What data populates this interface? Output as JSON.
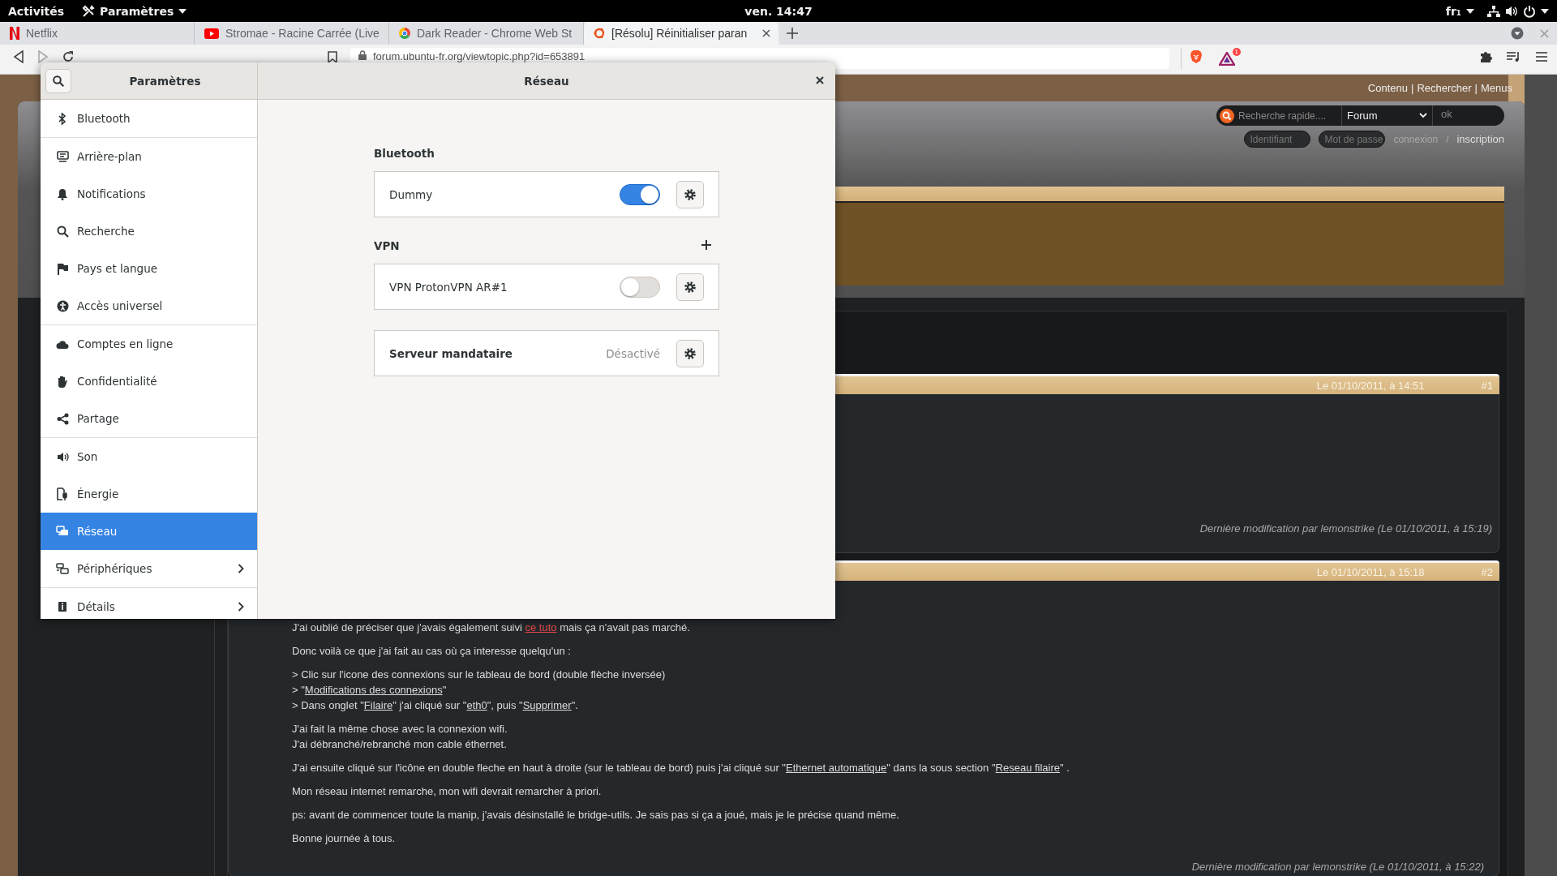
{
  "top_bar": {
    "activities": "Activités",
    "app_menu": "Paramètres",
    "clock": "ven. 14:47",
    "keyboard_layout": "fr₁"
  },
  "browser": {
    "tabs": [
      {
        "title": "Netflix",
        "selected": false
      },
      {
        "title": "Stromae - Racine Carrée (Live",
        "selected": false
      },
      {
        "title": "Dark Reader - Chrome Web St",
        "selected": false
      },
      {
        "title": "[Résolu] Réinitialiser paran",
        "selected": true
      }
    ],
    "address": "forum.ubuntu-fr.org/viewtopic.php?id=653891",
    "rewards_badge": "1"
  },
  "forum": {
    "top_links": [
      "Contenu",
      "Rechercher",
      "Menus"
    ],
    "link_separator": "|",
    "search": {
      "placeholder": "Recherche rapide....",
      "scope": "Forum",
      "submit": "ok"
    },
    "login": {
      "username_placeholder": "Identifiant",
      "password_placeholder": "Mot de passe",
      "login_link": "connexion",
      "separator": "/",
      "register_link": "inscription"
    },
    "posts": [
      {
        "date": "Le 01/10/2011, à 14:51",
        "number": "#1",
        "edit_note": "Dernière modification par lemonstrike (Le 01/10/2011, à 15:19)"
      },
      {
        "date": "Le 01/10/2011, à 15:18",
        "number": "#2",
        "paragraphs": [
          {
            "lines": [
              [
                {
                  "kind": "text",
                  "text": "J'ai oublié de préciser que j'avais également suivi "
                },
                {
                  "kind": "link",
                  "text": "ce tuto",
                  "color": "#e5484d"
                },
                {
                  "kind": "text",
                  "text": " mais ça n'avait pas marché."
                }
              ]
            ]
          },
          {
            "lines": [
              [
                {
                  "kind": "text",
                  "text": "Donc voilà ce que j'ai fait au cas où ça interesse quelqu'un :"
                }
              ]
            ]
          },
          {
            "lines": [
              [
                {
                  "kind": "text",
                  "text": "> Clic sur l'icone des connexions sur le tableau de bord (double flèche inversée)"
                }
              ],
              [
                {
                  "kind": "text",
                  "text": "> \""
                },
                {
                  "kind": "link",
                  "text": "Modifications des connexions",
                  "color": "#dcdcdc"
                },
                {
                  "kind": "text",
                  "text": "\""
                }
              ],
              [
                {
                  "kind": "text",
                  "text": "> Dans onglet \""
                },
                {
                  "kind": "link",
                  "text": "Filaire",
                  "color": "#dcdcdc"
                },
                {
                  "kind": "text",
                  "text": "\" j'ai cliqué sur \""
                },
                {
                  "kind": "link",
                  "text": "eth0",
                  "color": "#dcdcdc"
                },
                {
                  "kind": "text",
                  "text": "\", puis \""
                },
                {
                  "kind": "link",
                  "text": "Supprimer",
                  "color": "#dcdcdc"
                },
                {
                  "kind": "text",
                  "text": "\"."
                }
              ]
            ]
          },
          {
            "lines": [
              [
                {
                  "kind": "text",
                  "text": "J'ai fait la même chose avec la connexion wifi."
                }
              ],
              [
                {
                  "kind": "text",
                  "text": "J'ai débranché/rebranché mon cable éthernet."
                }
              ]
            ]
          },
          {
            "lines": [
              [
                {
                  "kind": "text",
                  "text": "J'ai ensuite cliqué sur l'icône en double fleche en haut à droite (sur le tableau de bord) puis j'ai cliqué sur \""
                },
                {
                  "kind": "link",
                  "text": "Ethernet automatique",
                  "color": "#dcdcdc"
                },
                {
                  "kind": "text",
                  "text": "\" dans la sous section \""
                },
                {
                  "kind": "link",
                  "text": "Reseau filaire",
                  "color": "#dcdcdc"
                },
                {
                  "kind": "text",
                  "text": "\" ."
                }
              ]
            ]
          },
          {
            "lines": [
              [
                {
                  "kind": "text",
                  "text": "Mon réseau internet remarche, mon wifi devrait remarcher à priori."
                }
              ]
            ]
          },
          {
            "lines": [
              [
                {
                  "kind": "text",
                  "text": "ps: avant de commencer toute la manip, j'avais désinstallé le bridge-utils. Je sais pas si ça a joué, mais je le précise quand même."
                }
              ]
            ]
          },
          {
            "lines": [
              [
                {
                  "kind": "text",
                  "text": "Bonne journée à tous."
                }
              ]
            ]
          }
        ],
        "edit_note": "Dernière modification par lemonstrike (Le 01/10/2011, à 15:22)"
      }
    ]
  },
  "settings": {
    "sidebar_title": "Paramètres",
    "page_title": "Réseau",
    "sidebar": [
      {
        "items": [
          {
            "label": "Bluetooth",
            "selected": false,
            "has_arrow": false
          }
        ]
      },
      {
        "items": [
          {
            "label": "Arrière-plan",
            "selected": false,
            "has_arrow": false
          },
          {
            "label": "Notifications",
            "selected": false,
            "has_arrow": false
          },
          {
            "label": "Recherche",
            "selected": false,
            "has_arrow": false
          },
          {
            "label": "Pays et langue",
            "selected": false,
            "has_arrow": false
          },
          {
            "label": "Accès universel",
            "selected": false,
            "has_arrow": false
          }
        ]
      },
      {
        "items": [
          {
            "label": "Comptes en ligne",
            "selected": false,
            "has_arrow": false
          },
          {
            "label": "Confidentialité",
            "selected": false,
            "has_arrow": false
          },
          {
            "label": "Partage",
            "selected": false,
            "has_arrow": false
          }
        ]
      },
      {
        "items": [
          {
            "label": "Son",
            "selected": false,
            "has_arrow": false
          },
          {
            "label": "Énergie",
            "selected": false,
            "has_arrow": false
          },
          {
            "label": "Réseau",
            "selected": true,
            "has_arrow": false
          },
          {
            "label": "Périphériques",
            "selected": false,
            "has_arrow": true
          }
        ]
      },
      {
        "items": [
          {
            "label": "Détails",
            "selected": false,
            "has_arrow": true
          }
        ]
      }
    ],
    "sections": [
      {
        "heading": "Bluetooth",
        "rows": [
          {
            "kind": "switch",
            "label": "Dummy",
            "on": true
          }
        ]
      },
      {
        "heading": "VPN",
        "add_button": true,
        "rows": [
          {
            "kind": "switch",
            "label": "VPN ProtonVPN AR#1",
            "on": false
          }
        ]
      },
      {
        "rows": [
          {
            "kind": "status",
            "label": "Serveur mandataire",
            "status": "Désactivé"
          }
        ]
      }
    ]
  }
}
